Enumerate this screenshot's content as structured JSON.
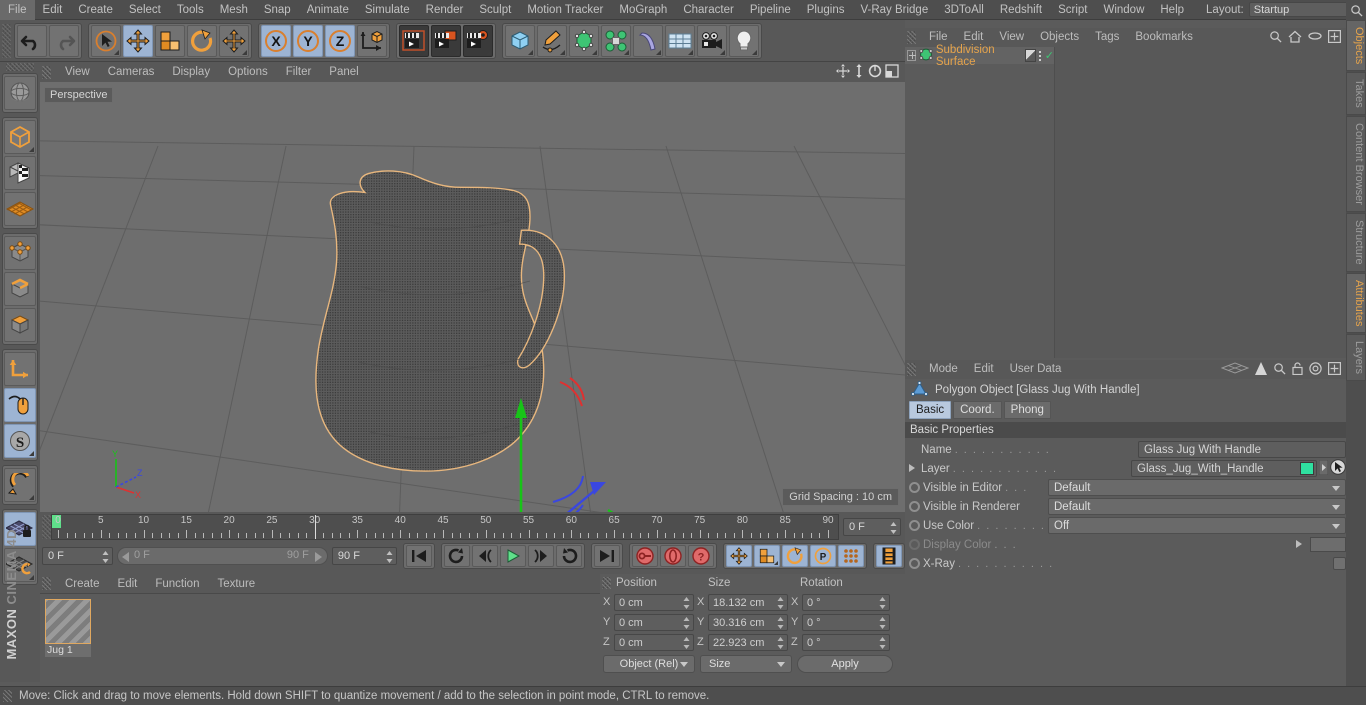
{
  "app": {
    "name": "MAXON CINEMA 4D",
    "logo_top": "MAXON",
    "logo_bottom": "CINEMA 4D"
  },
  "menubar": {
    "items": [
      "File",
      "Edit",
      "Create",
      "Select",
      "Tools",
      "Mesh",
      "Snap",
      "Animate",
      "Simulate",
      "Render",
      "Sculpt",
      "Motion Tracker",
      "MoGraph",
      "Character",
      "Pipeline",
      "Plugins",
      "V-Ray Bridge",
      "3DToAll",
      "Redshift",
      "Script",
      "Window",
      "Help"
    ],
    "layout_label": "Layout:",
    "layout_value": "Startup",
    "search_icon": "search-icon"
  },
  "toolbar": {
    "groups": [
      {
        "name": "undo-redo",
        "buttons": [
          {
            "name": "undo-button",
            "icon": "undo-arrow-icon",
            "selected": false
          },
          {
            "name": "redo-button",
            "icon": "redo-arrow-icon",
            "selected": false,
            "disabled": true
          }
        ]
      },
      {
        "name": "transform-tools",
        "buttons": [
          {
            "name": "live-selection-tool",
            "icon": "cursor-circle-icon",
            "selected": false
          },
          {
            "name": "move-tool",
            "icon": "move-arrows-icon",
            "selected": true
          },
          {
            "name": "scale-tool",
            "icon": "scale-box-icon",
            "selected": false
          },
          {
            "name": "rotate-tool",
            "icon": "rotate-arc-icon",
            "selected": false
          },
          {
            "name": "move-duplicate-tool",
            "icon": "move-arrows-icon",
            "selected": false
          }
        ]
      },
      {
        "name": "axis-locks",
        "buttons": [
          {
            "name": "lock-x-axis",
            "icon": "x-axis-icon",
            "label": "X",
            "selected": true
          },
          {
            "name": "lock-y-axis",
            "icon": "y-axis-icon",
            "label": "Y",
            "selected": true
          },
          {
            "name": "lock-z-axis",
            "icon": "z-axis-icon",
            "label": "Z",
            "selected": true
          },
          {
            "name": "world-object-coordinates",
            "icon": "world-axis-cube-icon",
            "selected": false
          }
        ]
      },
      {
        "name": "render-tools",
        "buttons": [
          {
            "name": "render-view-button",
            "icon": "render-clapper-icon",
            "selected": false
          },
          {
            "name": "render-to-picture-viewer-button",
            "icon": "render-picture-icon",
            "selected": false
          },
          {
            "name": "render-settings-button",
            "icon": "render-gear-icon",
            "selected": false
          }
        ]
      },
      {
        "name": "object-creation",
        "buttons": [
          {
            "name": "add-cube-button",
            "icon": "blue-cube-icon",
            "selected": false
          },
          {
            "name": "add-spline-button",
            "icon": "pen-spline-icon",
            "selected": false
          },
          {
            "name": "add-nurbs-button",
            "icon": "green-cube-nurbs-icon",
            "selected": false
          },
          {
            "name": "add-array-button",
            "icon": "green-cluster-icon",
            "selected": false
          },
          {
            "name": "add-bend-deformer-button",
            "icon": "purple-bend-icon",
            "selected": false
          },
          {
            "name": "add-scene-environment-button",
            "icon": "floor-grid-icon",
            "selected": false
          },
          {
            "name": "add-camera-button",
            "icon": "camera-icon",
            "selected": false
          },
          {
            "name": "add-light-button",
            "icon": "lightbulb-icon",
            "selected": false
          }
        ]
      }
    ]
  },
  "left_toolbar": {
    "groups": [
      {
        "name": "rotate-view",
        "buttons": [
          {
            "name": "make-editable-globe-button",
            "icon": "globe-wire-icon",
            "selected": false
          }
        ]
      },
      {
        "name": "selection-modes",
        "buttons": [
          {
            "name": "model-mode-button",
            "icon": "model-cube-icon",
            "selected": true
          },
          {
            "name": "texture-mode-button",
            "icon": "texture-checker-cube-icon",
            "selected": false
          },
          {
            "name": "workplane-mode-button",
            "icon": "orange-grid-plane-icon",
            "selected": false
          }
        ]
      },
      {
        "name": "component-modes",
        "buttons": [
          {
            "name": "points-mode-button",
            "icon": "points-cube-icon",
            "selected": false
          },
          {
            "name": "edges-mode-button",
            "icon": "edges-cube-icon",
            "selected": false
          },
          {
            "name": "polygons-mode-button",
            "icon": "polygons-cube-icon",
            "selected": false
          }
        ]
      },
      {
        "name": "axis-snap",
        "buttons": [
          {
            "name": "enable-axis-modification-button",
            "icon": "axis-l-icon",
            "selected": false
          },
          {
            "name": "enable-snapping-button",
            "icon": "mouse-cursor-icon",
            "selected": true
          },
          {
            "name": "soft-selection-button",
            "icon": "s-circle-icon",
            "selected": true
          }
        ]
      },
      {
        "name": "magnet",
        "buttons": [
          {
            "name": "magnet-tool-button",
            "icon": "magnet-icon",
            "selected": false
          }
        ]
      },
      {
        "name": "viewport-locks",
        "buttons": [
          {
            "name": "lock-workplane-button",
            "icon": "grid-lock-icon",
            "selected": true
          },
          {
            "name": "planar-workplane-button",
            "icon": "grid-rotate-icon",
            "selected": false
          }
        ]
      }
    ]
  },
  "viewport": {
    "menu": [
      "View",
      "Cameras",
      "Display",
      "Options",
      "Filter",
      "Panel"
    ],
    "icons": [
      "move-view-icon",
      "scale-view-icon",
      "rotate-view-icon",
      "maximize-view-icon"
    ],
    "perspective_label": "Perspective",
    "grid_spacing_label": "Grid Spacing : 10 cm",
    "axis_gizmo": {
      "x": "X",
      "y": "Y",
      "z": "Z"
    },
    "object_outline_color": "#e8b77e",
    "background_color": "#6e6e6e"
  },
  "timeline": {
    "frame_numbers": [
      0,
      5,
      10,
      15,
      20,
      25,
      30,
      35,
      40,
      45,
      50,
      55,
      60,
      65,
      70,
      75,
      80,
      85,
      90
    ],
    "current_frame_field": "0 F",
    "start_field": "0 F",
    "slider_left": "0 F",
    "slider_right": "90 F",
    "end_field": "90 F",
    "playhead_frame": 30,
    "transport": [
      {
        "name": "go-to-start-button",
        "icon": "skip-back-icon"
      },
      {
        "name": "play-backwards-loop-button",
        "icon": "loop-back-icon"
      },
      {
        "name": "previous-frame-button",
        "icon": "step-back-icon"
      },
      {
        "name": "play-button",
        "icon": "play-icon"
      },
      {
        "name": "next-frame-button",
        "icon": "step-forward-icon"
      },
      {
        "name": "play-forwards-loop-button",
        "icon": "loop-forward-icon"
      },
      {
        "name": "go-to-end-button",
        "icon": "skip-forward-icon"
      }
    ],
    "keyframe_buttons": [
      {
        "name": "record-active-objects-button",
        "icon": "key-record-icon"
      },
      {
        "name": "autokeying-button",
        "icon": "auto-key-icon"
      },
      {
        "name": "keyframe-selection-button",
        "icon": "question-key-icon"
      }
    ],
    "key_toggles": [
      {
        "name": "position-key-button",
        "icon": "move-arrows-icon",
        "selected": true
      },
      {
        "name": "scale-key-button",
        "icon": "scale-box-icon",
        "selected": true
      },
      {
        "name": "rotation-key-button",
        "icon": "rotate-arc-icon",
        "selected": true
      },
      {
        "name": "parameter-key-button",
        "icon": "p-circle-icon",
        "selected": true
      },
      {
        "name": "point-level-animation-button",
        "icon": "dots-grid-icon",
        "selected": true
      }
    ],
    "filmstrip_button": {
      "name": "timeline-filmstrip-button",
      "icon": "filmstrip-icon",
      "selected": true
    }
  },
  "material_manager": {
    "menu": [
      "Create",
      "Edit",
      "Function",
      "Texture"
    ],
    "materials": [
      {
        "name": "Jug 1",
        "selected": true
      }
    ]
  },
  "coordinates": {
    "headers": [
      "Position",
      "Size",
      "Rotation"
    ],
    "rows": [
      {
        "axis": "X",
        "position": "0 cm",
        "size": "18.132 cm",
        "rotation": "0 °"
      },
      {
        "axis": "Y",
        "position": "0 cm",
        "size": "30.316 cm",
        "rotation": "0 °"
      },
      {
        "axis": "Z",
        "position": "0 cm",
        "size": "22.923 cm",
        "rotation": "0 °"
      }
    ],
    "mode_dropdown": "Object (Rel)",
    "size_dropdown": "Size",
    "apply_button": "Apply"
  },
  "object_manager": {
    "menu": [
      "File",
      "Edit",
      "View",
      "Objects",
      "Tags",
      "Bookmarks"
    ],
    "icons": [
      "search-icon",
      "home-icon",
      "ellipse-icon",
      "plus-box-icon"
    ],
    "objects": [
      {
        "name": "Subdivision Surface",
        "icon": "subdivision-surface-icon",
        "expandable": true,
        "tag": "material-tag",
        "check": "✓"
      }
    ]
  },
  "attributes_manager": {
    "menu": [
      "Mode",
      "Edit",
      "User Data"
    ],
    "icons": [
      "plane-wire-icon",
      "play-triangle-icon",
      "search-icon",
      "lock-icon",
      "target-icon",
      "plus-box-icon"
    ],
    "title": "Polygon Object [Glass Jug With Handle]",
    "title_icon": "polygon-object-icon",
    "tabs": [
      {
        "label": "Basic",
        "selected": true
      },
      {
        "label": "Coord.",
        "selected": false
      },
      {
        "label": "Phong",
        "selected": false
      }
    ],
    "section_title": "Basic Properties",
    "fields": [
      {
        "name": "name-field",
        "label": "Name",
        "dots": ". . . . . . . . . . .",
        "type": "text",
        "value": "Glass Jug With Handle",
        "radio": false
      },
      {
        "name": "layer-field",
        "label": "Layer",
        "dots": ". . . . . . . . . . . .",
        "type": "layer",
        "value": "Glass_Jug_With_Handle",
        "swatch": "#2fe0a0",
        "radio": false,
        "arrow": true
      },
      {
        "name": "visible-in-editor-field",
        "label": "Visible in Editor",
        "dots": ". . .",
        "type": "dropdown",
        "value": "Default",
        "radio": true
      },
      {
        "name": "visible-in-renderer-field",
        "label": "Visible in Renderer",
        "dots": "",
        "type": "dropdown",
        "value": "Default",
        "radio": true
      },
      {
        "name": "use-color-field",
        "label": "Use Color",
        "dots": ". . . . . . . .",
        "type": "dropdown",
        "value": "Off",
        "radio": true
      },
      {
        "name": "display-color-field",
        "label": "Display Color",
        "dots": ". . .",
        "type": "color",
        "value": "",
        "radio": true,
        "disabled": true,
        "arrow": true
      },
      {
        "name": "x-ray-field",
        "label": "X-Ray",
        "dots": ". . . . . . . . . . .",
        "type": "checkbox",
        "value": "",
        "radio": true,
        "checked": false
      }
    ]
  },
  "vertical_tabs": [
    {
      "label": "Objects",
      "selected": true
    },
    {
      "label": "Takes",
      "selected": false
    },
    {
      "label": "Content Browser",
      "selected": false
    },
    {
      "label": "Structure",
      "selected": false
    },
    {
      "label": "Attributes",
      "selected": true
    },
    {
      "label": "Layers",
      "selected": false
    }
  ],
  "statusbar": {
    "message": "Move: Click and drag to move elements. Hold down SHIFT to quantize movement / add to the selection in point mode, CTRL to remove."
  },
  "colors": {
    "accent_orange": "#e6a44c",
    "selection_blue": "#9db4d3",
    "axis_x": "#e03030",
    "axis_y": "#17c417",
    "axis_z": "#3a47e0",
    "panel_bg": "#5b5b5b",
    "toolbar_bg": "#585858"
  }
}
